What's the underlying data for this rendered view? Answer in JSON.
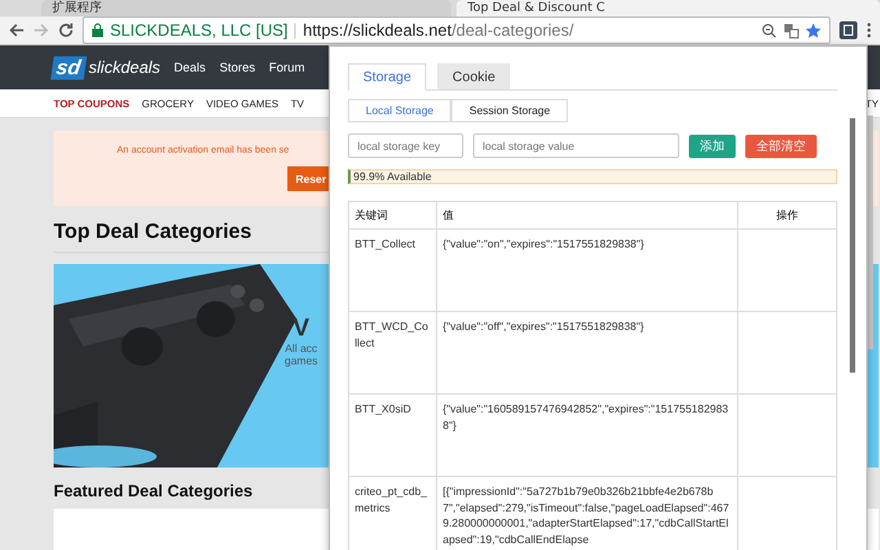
{
  "browser": {
    "tabs": [
      {
        "title": "扩展程序",
        "selected": false
      },
      {
        "title": "Top Deal & Discount C",
        "selected": true
      }
    ],
    "address": {
      "org": "SLICKDEALS, LLC [US]",
      "url_host": "https://slickdeals.net",
      "url_path": "/deal-categories/"
    }
  },
  "site": {
    "logo_mark": "sd",
    "logo_text": "slickdeals",
    "nav": [
      "Deals",
      "Stores",
      "Forum"
    ],
    "subnav": [
      {
        "label": "TOP COUPONS",
        "highlight": true
      },
      {
        "label": "GROCERY",
        "highlight": false
      },
      {
        "label": "VIDEO GAMES",
        "highlight": false
      },
      {
        "label": "TV",
        "highlight": false
      },
      {
        "label": "TY",
        "highlight": false
      }
    ],
    "alert": {
      "text": "An account activation email has been se",
      "button": "Reser"
    },
    "heading": "Top Deal Categories",
    "banner": {
      "kind": "picture",
      "title": "V",
      "lines": [
        "All acc",
        "games"
      ]
    },
    "featured_heading": "Featured Deal Categories"
  },
  "popup": {
    "tabs": [
      {
        "label": "Storage",
        "selected": true
      },
      {
        "label": "Cookie",
        "selected": false
      }
    ],
    "subtabs": [
      {
        "label": "Local Storage",
        "selected": true
      },
      {
        "label": "Session Storage",
        "selected": false
      }
    ],
    "key_field": {
      "placeholder": "local storage key"
    },
    "value_field": {
      "placeholder": "local storage value"
    },
    "add_button": "添加",
    "clear_button": "全部清空",
    "available": "99.9% Available",
    "table": {
      "columns": [
        "关键词",
        "值",
        "操作"
      ],
      "rows": [
        {
          "key": "BTT_Collect",
          "value": "{\"value\":\"on\",\"expires\":\"1517551829838\"}"
        },
        {
          "key": "BTT_WCD_Collect",
          "value": "{\"value\":\"off\",\"expires\":\"1517551829838\"}"
        },
        {
          "key": "BTT_X0siD",
          "value": "{\"value\":\"160589157476942852\",\"expires\":\"1517551829838\"}"
        },
        {
          "key": "criteo_pt_cdb_metrics",
          "value": "[{\"impressionId\":\"5a727b1b79e0b326b21bbfe4e2b678b7\",\"elapsed\":279,\"isTimeout\":false,\"pageLoadElapsed\":4679.280000000001,\"adapterStartElapsed\":17,\"cdbCallStartElapsed\":19,\"cdbCallEndElapse"
        }
      ]
    }
  }
}
